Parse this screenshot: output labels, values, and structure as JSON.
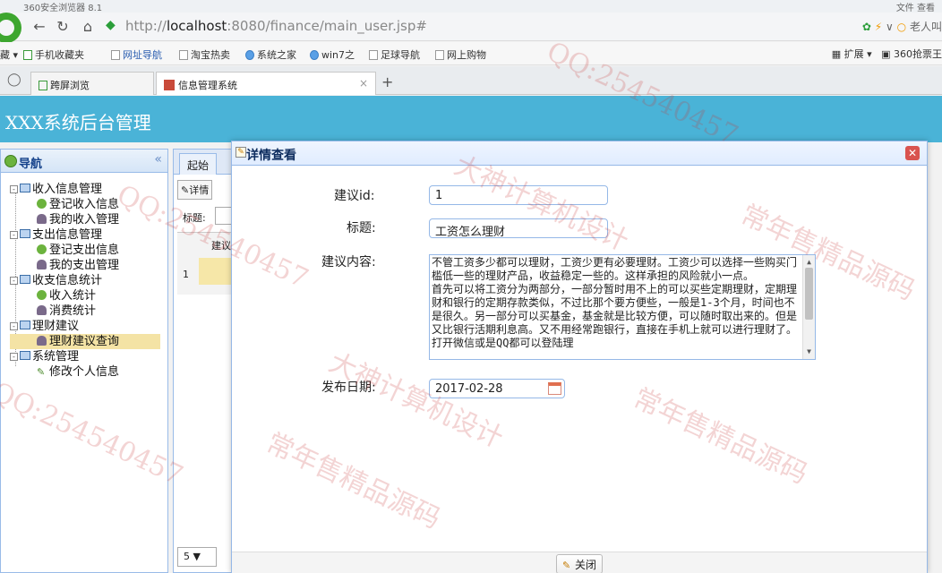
{
  "browser": {
    "window_title": "360安全浏览器 8.1",
    "menu_right": "文件  查看",
    "url_prefix": "http://",
    "url_host": "localhost",
    "url_rest": ":8080/finance/main_user.jsp#",
    "addr_right_text": "老人叫",
    "bookmarks": [
      "藏",
      "手机收藏夹",
      "网址导航",
      "淘宝热卖",
      "系统之家",
      "win7之",
      "足球导航",
      "网上购物"
    ],
    "bookmarks_right": [
      "扩展",
      "360抢票王"
    ],
    "tabs": [
      {
        "label": "跨屏浏览"
      },
      {
        "label": "信息管理系统"
      }
    ],
    "tab_close": "×",
    "tab_add": "+"
  },
  "app": {
    "title": "XXX系统后台管理"
  },
  "sidebar": {
    "title": "导航",
    "collapse": "«",
    "tree": [
      {
        "label": "收入信息管理",
        "type": "folder"
      },
      {
        "label": "登记收入信息",
        "type": "add"
      },
      {
        "label": "我的收入管理",
        "type": "user"
      },
      {
        "label": "支出信息管理",
        "type": "folder"
      },
      {
        "label": "登记支出信息",
        "type": "add"
      },
      {
        "label": "我的支出管理",
        "type": "user"
      },
      {
        "label": "收支信息统计",
        "type": "folder"
      },
      {
        "label": "收入统计",
        "type": "add"
      },
      {
        "label": "消费统计",
        "type": "user"
      },
      {
        "label": "理财建议",
        "type": "folder"
      },
      {
        "label": "理财建议查询",
        "type": "user",
        "selected": true
      },
      {
        "label": "系统管理",
        "type": "folder"
      },
      {
        "label": "修改个人信息",
        "type": "pen"
      }
    ]
  },
  "center": {
    "tab": "起始",
    "toolbar_btn": "详情",
    "filter_label": "标题:",
    "grid_col": "建议",
    "row_num": "1",
    "pager_size": "5 ▼"
  },
  "dialog": {
    "title": "详情查看",
    "close_x": "✕",
    "fields": {
      "id_label": "建议id:",
      "id_value": "1",
      "title_label": "标题:",
      "title_value": "工资怎么理财",
      "content_label": "建议内容:",
      "content_value": "不管工资多少都可以理财，工资少更有必要理财。工资少可以选择一些购买门槛低一些的理财产品，收益稳定一些的。这样承担的风险就小一点。\n首先可以将工资分为两部分，一部分暂时用不上的可以买些定期理财，定期理财和银行的定期存款类似，不过比那个要方便些，一般是1-3个月，时间也不是很久。另一部分可以买基金，基金就是比较方便，可以随时取出来的。但是又比银行活期利息高。又不用经常跑银行，直接在手机上就可以进行理财了。打开微信或是QQ都可以登陆理",
      "date_label": "发布日期:",
      "date_value": "2017-02-28"
    },
    "close_button": "关闭"
  },
  "watermarks": [
    "QQ:254540457",
    "大神计算机设计",
    "常年售精品源码",
    "QQ:254540457",
    "常年售精品源码",
    "大神计算机设计",
    "QQ:254540457",
    "常年售精品源码"
  ]
}
